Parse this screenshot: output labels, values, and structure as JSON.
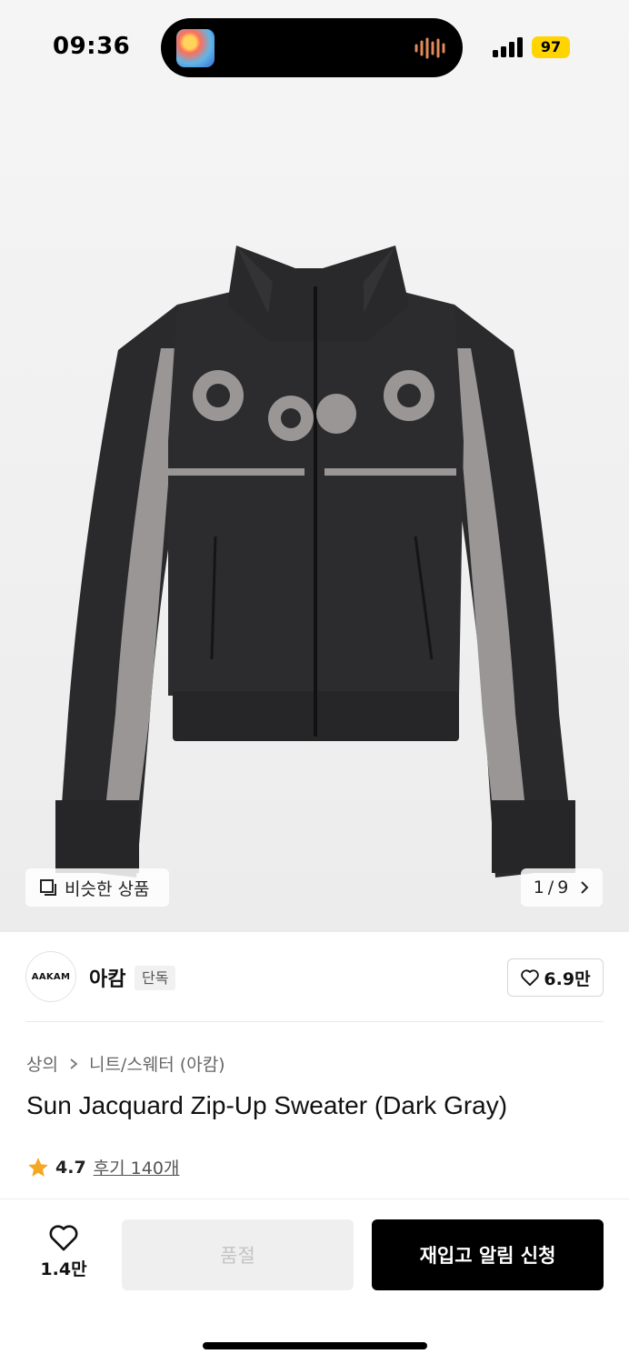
{
  "status_bar": {
    "time": "09:36",
    "battery": "97"
  },
  "product_image": {
    "similar_label": "비슷한 상품",
    "page_current": "1",
    "page_separator": "/",
    "page_total": "9"
  },
  "brand": {
    "logo_text": "AAKAM",
    "name": "아캄",
    "exclusive_badge": "단독",
    "likes": "6.9만"
  },
  "breadcrumb": {
    "category": "상의",
    "subcategory": "니트/스웨터 (아캄)"
  },
  "product": {
    "title": "Sun Jacquard Zip-Up Sweater (Dark Gray)",
    "rating": "4.7",
    "reviews": "후기 140개"
  },
  "bottom_bar": {
    "wish_count": "1.4만",
    "soldout_label": "품절",
    "restock_label": "재입고 알림 신청"
  },
  "colors": {
    "accent_star": "#f5a623",
    "battery": "#ffd400",
    "cta": "#000000"
  },
  "icons": [
    "waveform-icon",
    "signal-icon",
    "similar-icon",
    "chevron-right-icon",
    "heart-icon",
    "star-icon"
  ]
}
